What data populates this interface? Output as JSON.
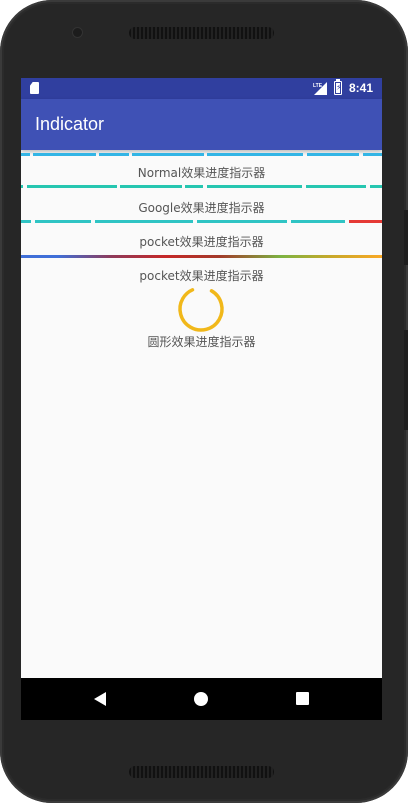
{
  "status_bar": {
    "network_label": "LTE",
    "time": "8:41",
    "icons": [
      "sd-card-icon",
      "signal-icon",
      "battery-charging-icon"
    ]
  },
  "app_bar": {
    "title": "Indicator"
  },
  "indicators": [
    {
      "label": "Normal效果进度指示器",
      "color": "#33b5e5"
    },
    {
      "label": "Google效果进度指示器",
      "colors": [
        "#26c6b0",
        "#2fc4c4",
        "#e53935"
      ]
    },
    {
      "label": "pocket效果进度指示器",
      "gradient": [
        "#3f6fd8",
        "#c62828",
        "#7cb342",
        "#f9a825"
      ]
    },
    {
      "label": "pocket效果进度指示器",
      "spinner_color": "#f1b81a"
    },
    {
      "label": "圆形效果进度指示器"
    }
  ],
  "nav_bar": {
    "icons": [
      "back-icon",
      "home-icon",
      "recents-icon"
    ]
  }
}
